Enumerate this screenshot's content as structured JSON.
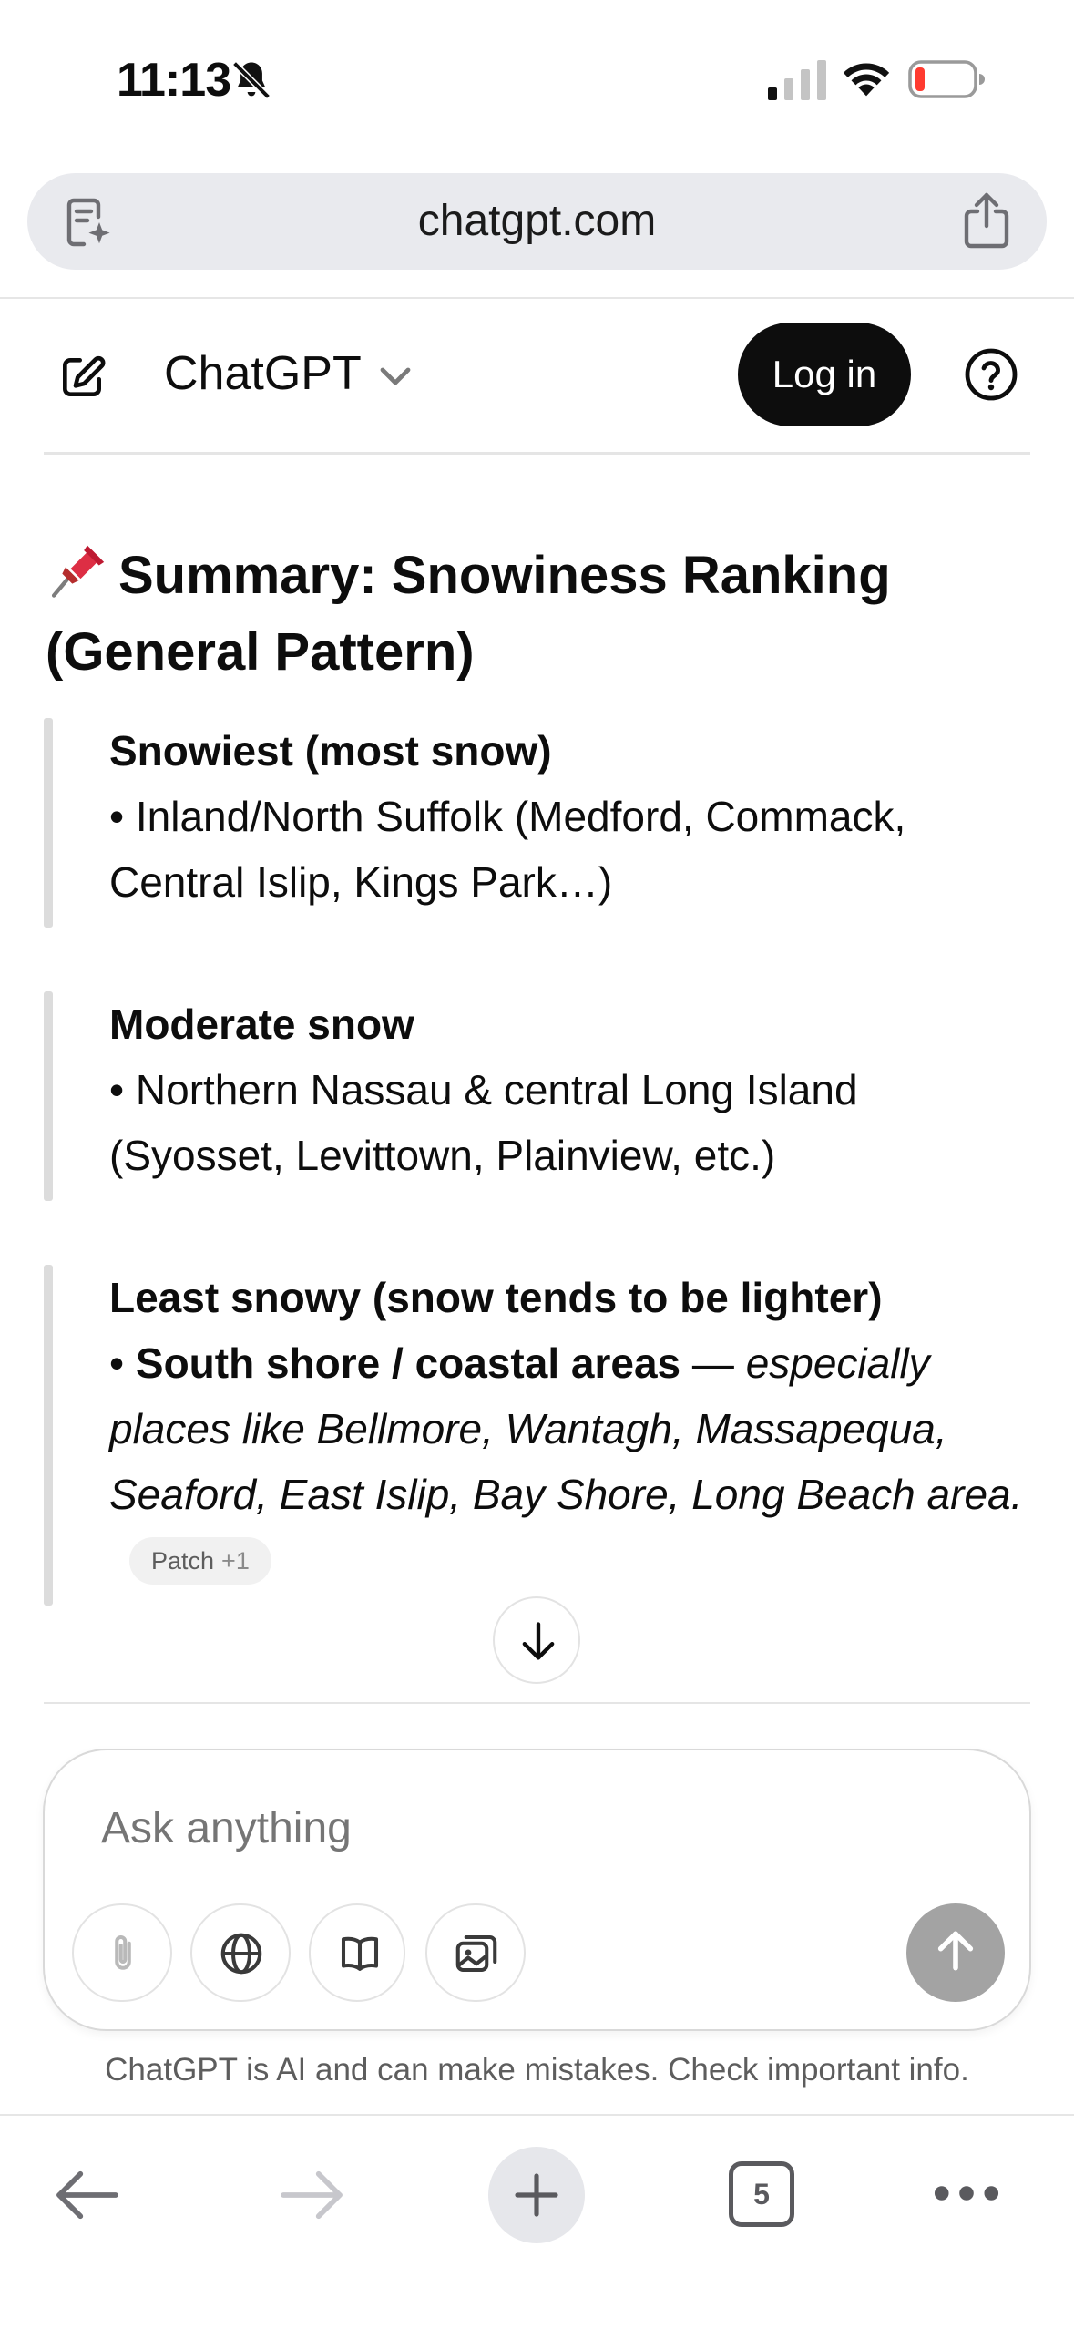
{
  "status_bar": {
    "time": "11:13"
  },
  "browser": {
    "url": "chatgpt.com",
    "open_tabs": "5"
  },
  "header": {
    "app_title": "ChatGPT",
    "login_label": "Log in"
  },
  "article": {
    "heading": "Summary: Snowiness Ranking (General Pattern)",
    "blocks": [
      {
        "title": "Snowiest (most snow)",
        "body": "• Inland/North Suffolk (Medford, Commack, Central Islip, Kings Park…)"
      },
      {
        "title": "Moderate snow",
        "body": "• Northern Nassau & central Long Island (Syosset, Levittown, Plainview, etc.)"
      },
      {
        "title": "Least snowy (snow tends to be lighter)",
        "bullet": "• ",
        "bold": "South shore / coastal areas",
        "dash": " — ",
        "italic": "especially places like Bellmore, Wantagh, Massapequa, Seaford, East Islip, Bay Shore, Long Beach area.",
        "badge_label": "Patch",
        "badge_count": "+1"
      }
    ]
  },
  "composer": {
    "placeholder": "Ask anything"
  },
  "disclaimer": "ChatGPT is AI and can make mistakes. Check important info."
}
